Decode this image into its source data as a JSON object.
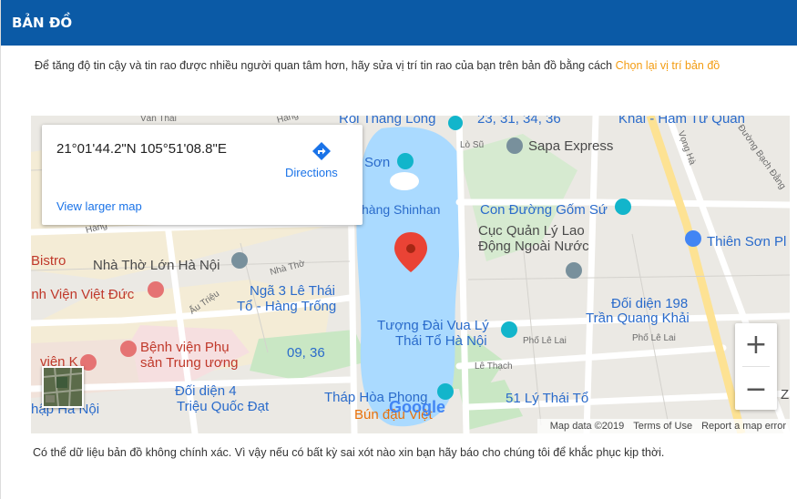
{
  "header": {
    "title": "BẢN ĐỒ"
  },
  "intro": {
    "text": "Để tăng độ tin cậy và tin rao được nhiều người quan tâm hơn, hãy sửa vị trí tin rao của bạn trên bản đồ bằng cách ",
    "link": "Chọn lại vị trí bản đồ"
  },
  "map": {
    "infocard": {
      "coordinates": "21°01'44.2\"N 105°51'08.8\"E",
      "directions": "Directions",
      "larger_map": "View larger map"
    },
    "labels": {
      "roi_thang_long": "Rối Thăng Long",
      "bus_routes_top": "23, 31, 34, 36",
      "khai_ham": "Khải - Hàm Tử Quan",
      "lo_su": "Lò Sũ",
      "sapa_express": "Sapa Express",
      "vong_ha": "Vọng Hà",
      "duong_bach_dang": "Đường Bạch Đằng",
      "son": "Sơn",
      "hang_shinhan": "hàng Shinhan",
      "con_duong_gom_su": "Con Đường Gốm Sứ",
      "cuc_quan_ly_1": "Cục Quản Lý Lao",
      "cuc_quan_ly_2": "Động Ngoài Nước",
      "thien_son": "Thiên Sơn Pl",
      "bistro": "Bistro",
      "nha_tho_lon": "Nhà Thờ Lớn Hà Nội",
      "nha_tho_street": "Nhà Thờ",
      "benh_vien_viet_duc": "ệnh Viện Việt Đức",
      "au_trieu": "Ấu Triệu",
      "nga3_1": "Ngã 3 Lê Thái",
      "nga3_2": "Tổ - Hàng Trống",
      "doi_dien_198_1": "Đối diện 198",
      "doi_dien_198_2": "Trần Quang Khải",
      "tuong_dai_1": "Tượng Đài Vua Lý",
      "tuong_dai_2": "Thái Tổ Hà Nội",
      "pho_le_lai": "Phố Lê Lai",
      "pho_le_lai_2": "Phố Lê Lai",
      "benh_vien_phu_san_1": "Bệnh viện Phụ",
      "benh_vien_phu_san_2": "sản Trung ương",
      "bus_09_36": "09, 36",
      "le_thach": "Lê Thạch",
      "benh_vien_k": "viện K",
      "doi_dien_4_1": "Đối diện 4",
      "doi_dien_4_2": "Triệu Quốc Đạt",
      "thap_hoa_phong": "Tháp Hòa Phong",
      "bun_dau_viet": "Bún đậu Việt",
      "ly_thai_to_51": "51 Lý Thái Tổ",
      "hap_ha_noi": "hập Hà Nội",
      "hang": "Hàng",
      "hang2": "Hàng",
      "van_thai": "Văn Thái",
      "z": "Z"
    },
    "zoom_in": "+",
    "zoom_out": "−",
    "google": "Google",
    "attribution": {
      "data": "Map data ©2019",
      "terms": "Terms of Use",
      "report": "Report a map error"
    }
  },
  "disclaimer": "Có thể dữ liệu bản đồ không chính xác. Vì vậy nếu có bất kỳ sai xót nào xin bạn hãy báo cho chúng tôi để khắc phục kịp thời.",
  "colors": {
    "header_bg": "#0b5aa6",
    "link_orange": "#f39c12",
    "lake": "#aadaff",
    "park": "#c8e6c9",
    "pin_red": "#ea4335",
    "directions_blue": "#1a73e8"
  }
}
